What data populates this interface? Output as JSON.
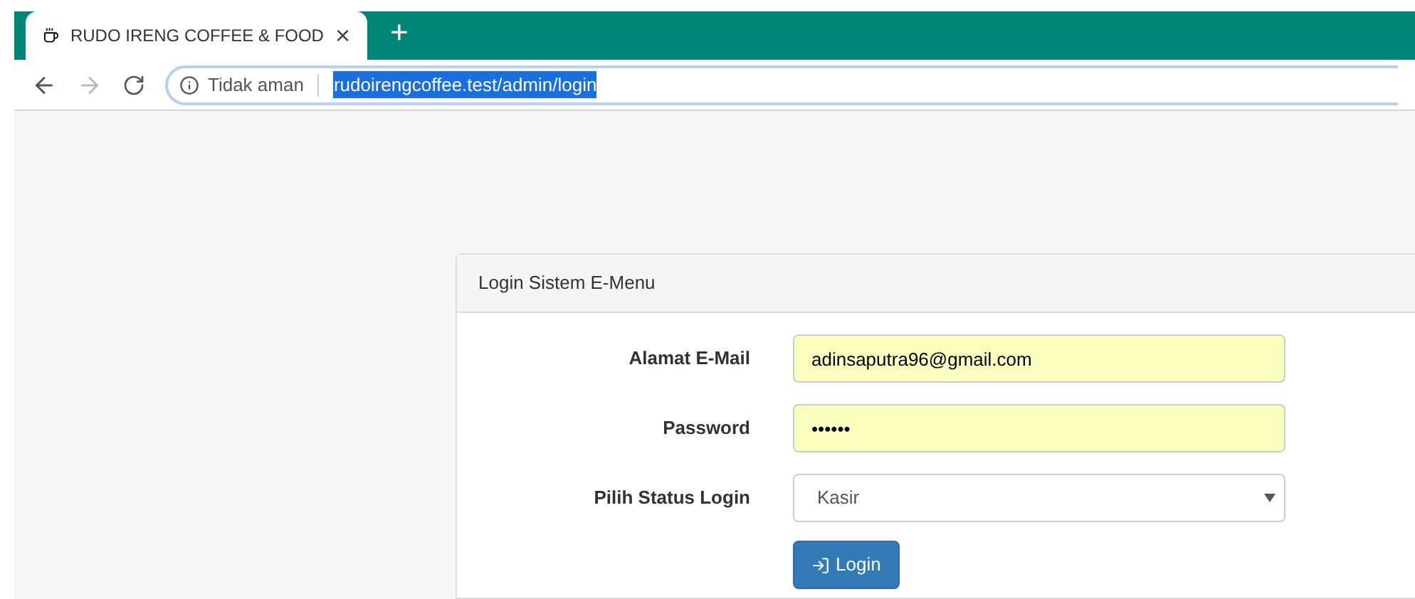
{
  "browser": {
    "tab": {
      "title": "RUDO IRENG COFFEE & FOOD",
      "close": "×"
    },
    "new_tab": "+",
    "address_bar": {
      "security": "Tidak aman",
      "url": "rudoirengcoffee.test/admin/login",
      "url_selected": true
    }
  },
  "panel": {
    "title": "Login Sistem E-Menu",
    "fields": [
      {
        "kind": "text",
        "label": "Alamat E-Mail",
        "value": "adinsaputra96@gmail.com",
        "autofilled": true
      },
      {
        "kind": "text",
        "label": "Password",
        "value": "••••••",
        "autofilled": true
      },
      {
        "kind": "select",
        "label": "Pilih Status Login",
        "value": "Kasir",
        "autofilled": false
      }
    ],
    "button": "Login"
  }
}
